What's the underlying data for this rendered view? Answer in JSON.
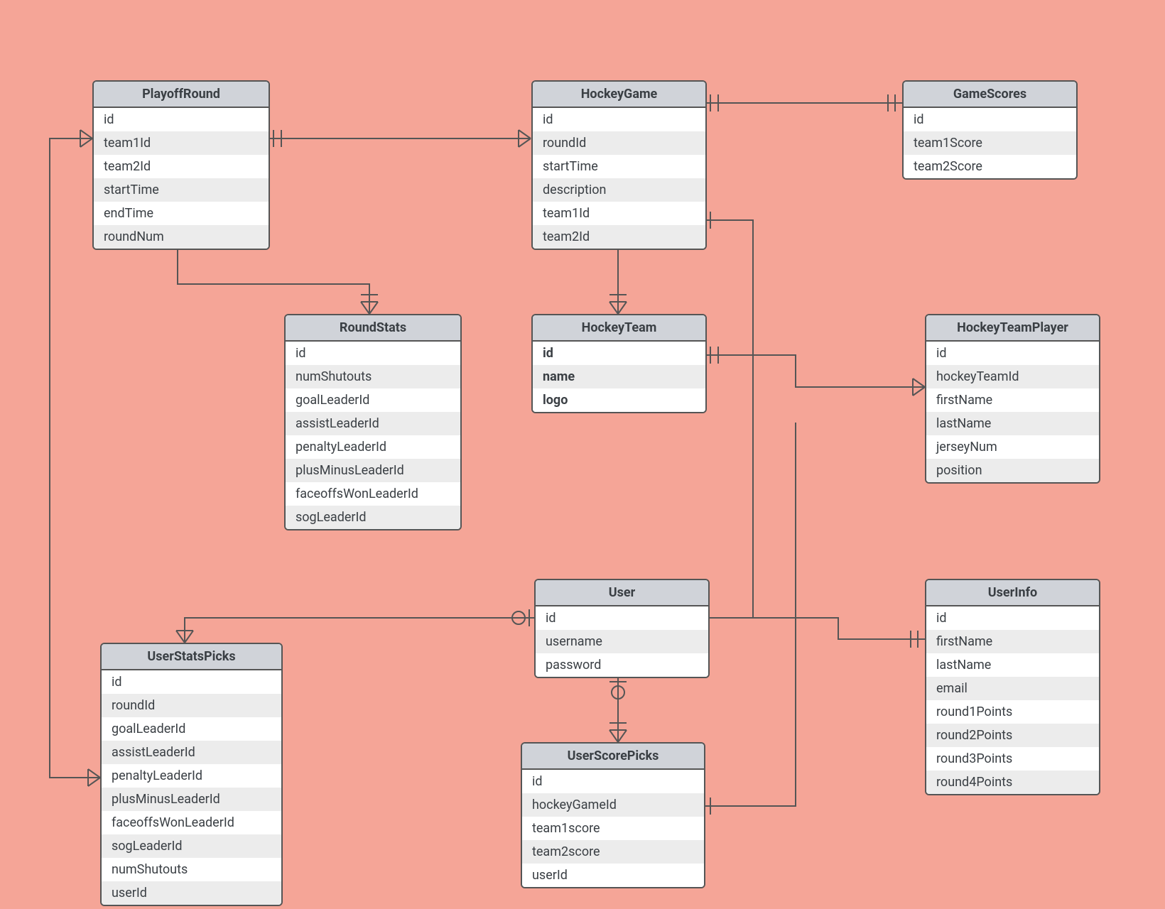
{
  "entities": {
    "playoffRound": {
      "title": "PlayoffRound",
      "fields": [
        "id",
        "team1Id",
        "team2Id",
        "startTime",
        "endTime",
        "roundNum"
      ]
    },
    "hockeyGame": {
      "title": "HockeyGame",
      "fields": [
        "id",
        "roundId",
        "startTime",
        "description",
        "team1Id",
        "team2Id"
      ]
    },
    "gameScores": {
      "title": "GameScores",
      "fields": [
        "id",
        "team1Score",
        "team2Score"
      ]
    },
    "roundStats": {
      "title": "RoundStats",
      "fields": [
        "id",
        "numShutouts",
        "goalLeaderId",
        "assistLeaderId",
        "penaltyLeaderId",
        "plusMinusLeaderId",
        "faceoffsWonLeaderId",
        "sogLeaderId"
      ]
    },
    "hockeyTeam": {
      "title": "HockeyTeam",
      "fields": [
        "id",
        "name",
        "logo"
      ]
    },
    "hockeyTeamPlayer": {
      "title": "HockeyTeamPlayer",
      "fields": [
        "id",
        "hockeyTeamId",
        "firstName",
        "lastName",
        "jerseyNum",
        "position"
      ]
    },
    "user": {
      "title": "User",
      "fields": [
        "id",
        "username",
        "password"
      ]
    },
    "userInfo": {
      "title": "UserInfo",
      "fields": [
        "id",
        "firstName",
        "lastName",
        "email",
        "round1Points",
        "round2Points",
        "round3Points",
        "round4Points"
      ]
    },
    "userStatsPicks": {
      "title": "UserStatsPicks",
      "fields": [
        "id",
        "roundId",
        "goalLeaderId",
        "assistLeaderId",
        "penaltyLeaderId",
        "plusMinusLeaderId",
        "faceoffsWonLeaderId",
        "sogLeaderId",
        "numShutouts",
        "userId"
      ]
    },
    "userScorePicks": {
      "title": "UserScorePicks",
      "fields": [
        "id",
        "hockeyGameId",
        "team1score",
        "team2score",
        "userId"
      ]
    }
  }
}
